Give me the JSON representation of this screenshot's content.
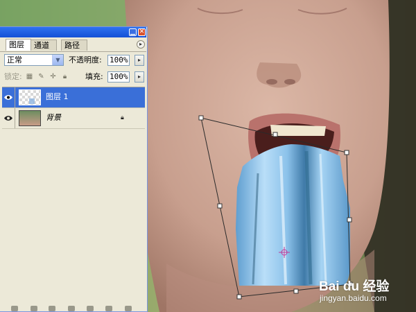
{
  "palette": {
    "tabs": [
      {
        "label": "图层"
      },
      {
        "label": "通道"
      },
      {
        "label": "路径"
      }
    ],
    "blend_mode": "正常",
    "opacity_label": "不透明度:",
    "opacity_value": "100%",
    "lock_label": "锁定:",
    "fill_label": "填充:",
    "fill_value": "100%",
    "layers": [
      {
        "name": "图层 1",
        "selected": true,
        "visible": true,
        "locked": false
      },
      {
        "name": "背景",
        "selected": false,
        "visible": true,
        "locked": true
      }
    ]
  },
  "watermark": {
    "logo": "Bai du 经验",
    "url": "jingyan.baidu.com"
  },
  "colors": {
    "titlebar": "#1450d6",
    "selection": "#3a6fd8",
    "panel_bg": "#ece9d8",
    "water": "#7fb2de"
  }
}
